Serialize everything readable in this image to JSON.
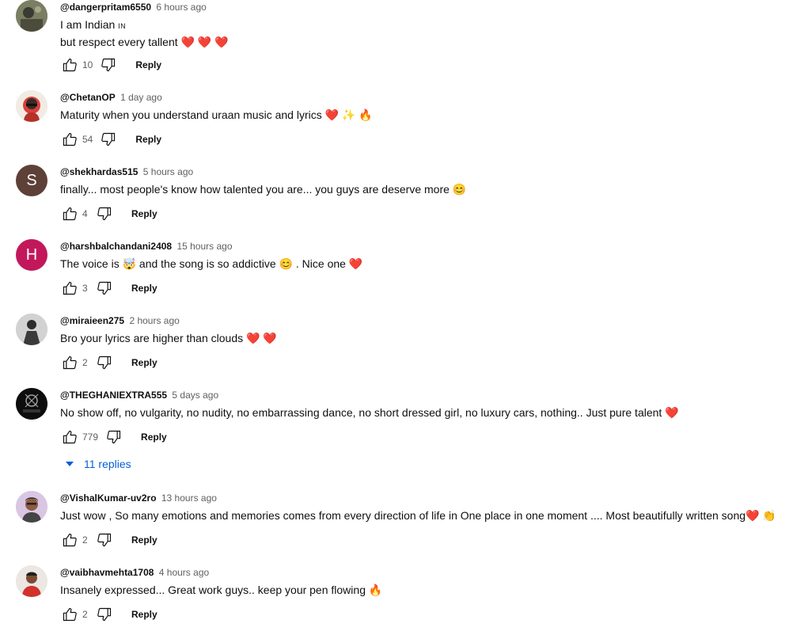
{
  "comments": [
    {
      "author": "@dangerpritam6550",
      "time": "6 hours ago",
      "line1": "I am Indian",
      "flag_text": "IN",
      "line2": "but respect every tallent ❤️ ❤️ ❤️",
      "likes": "10",
      "reply": "Reply",
      "avatar": {
        "type": "photo",
        "color": "#6b6f55"
      }
    },
    {
      "author": "@ChetanOP",
      "time": "1 day ago",
      "text": "Maturity when you understand uraan music and lyrics ❤️ ✨ 🔥",
      "likes": "54",
      "reply": "Reply",
      "avatar": {
        "type": "photo",
        "color": "#e9e2da"
      }
    },
    {
      "author": "@shekhardas515",
      "time": "5 hours ago",
      "text": "finally... most people's know how talented you are... you guys are deserve more 😊",
      "likes": "4",
      "reply": "Reply",
      "avatar": {
        "type": "letter",
        "letter": "S",
        "color": "#5d4037"
      }
    },
    {
      "author": "@harshbalchandani2408",
      "time": "15 hours ago",
      "text": "The voice is 🤯 and the song is so addictive 😊 . Nice one ❤️",
      "likes": "3",
      "reply": "Reply",
      "avatar": {
        "type": "letter",
        "letter": "H",
        "color": "#c2185b"
      }
    },
    {
      "author": "@miraieen275",
      "time": "2 hours ago",
      "text": "Bro your lyrics are higher than clouds ❤️ ❤️",
      "likes": "2",
      "reply": "Reply",
      "avatar": {
        "type": "photo",
        "color": "#c9c9c9"
      }
    },
    {
      "author": "@THEGHANIEXTRA555",
      "time": "5 days ago",
      "text": "No show off, no vulgarity, no nudity, no embarrassing dance, no short dressed girl, no luxury cars, nothing.. Just pure talent ❤️",
      "likes": "779",
      "reply": "Reply",
      "avatar": {
        "type": "logo",
        "color": "#111111",
        "logo_text": "THE GHANI"
      }
    },
    {
      "author": "@VishalKumar-uv2ro",
      "time": "13 hours ago",
      "text": "Just wow , So many emotions and memories  comes from every direction of life in One place in one moment ....  Most beautifully written song❤️ 👏",
      "likes": "2",
      "reply": "Reply",
      "avatar": {
        "type": "photo",
        "color": "#d8c3e0"
      }
    },
    {
      "author": "@vaibhavmehta1708",
      "time": "4 hours ago",
      "text": "Insanely expressed... Great work guys..  keep your pen flowing 🔥",
      "likes": "2",
      "reply": "Reply",
      "avatar": {
        "type": "photo",
        "color": "#e9e4df"
      }
    }
  ],
  "replies_toggle": "11 replies",
  "icons": {
    "like": "thumbs-up-icon",
    "dislike": "thumbs-down-icon",
    "expand": "caret-down-icon"
  },
  "colors": {
    "link": "#065fd4",
    "meta": "#606060",
    "text": "#0f0f0f"
  }
}
